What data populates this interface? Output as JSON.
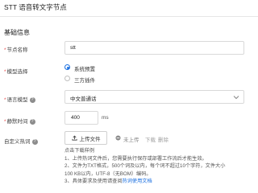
{
  "header": {
    "title": "STT 语音转文字节点"
  },
  "section": {
    "title": "基础信息"
  },
  "fields": {
    "node_name": {
      "label": "节点名称",
      "value": "stt"
    },
    "model_select": {
      "label": "模型选择",
      "options": [
        "系统预置",
        "三方插件"
      ],
      "selected": "系统预置"
    },
    "language_model": {
      "label": "语言模型",
      "value": "中文普通话",
      "help_icon": "question-circle-icon"
    },
    "silence_time": {
      "label": "静默时间",
      "value": "400",
      "unit": "ms",
      "help_icon": "question-circle-icon"
    },
    "custom_hotwords": {
      "label": "自定义热词",
      "help_icon": "question-circle-icon"
    }
  },
  "hotwords": {
    "upload_label": "上传文件",
    "status_label": "未上传",
    "download_label": "下载",
    "delete_label": "删除",
    "template_link": "点击下载样例",
    "notes": [
      "1、上传热词文件后，您需要执行保存或部署工作流后才能生效。",
      "2、文件为TXT格式，500个词及以内，每个词不超过10个字符，文件大小",
      "100 KB以内，UTF-8（无BOM）编码。"
    ],
    "note3_prefix": "3、具体要求及使用请查阅",
    "note3_link": "热词使用文档"
  },
  "colors": {
    "accent": "#1a6fe0",
    "required": "#e84b4b",
    "border": "#d9d9d9"
  }
}
